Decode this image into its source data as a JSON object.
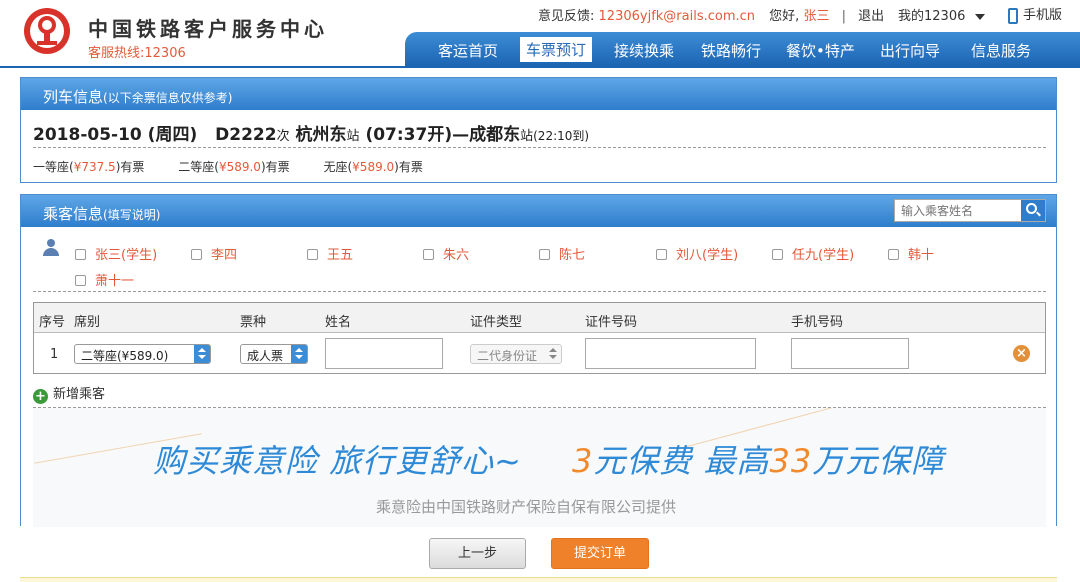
{
  "header": {
    "brand_title": "中国铁路客户服务中心",
    "hotline": "客服热线:12306",
    "feedback_label": "意见反馈:",
    "feedback_email": "12306yjfk@rails.com.cn",
    "greeting": "您好,",
    "user_name": "张三",
    "logout": "退出",
    "my12306": "我的12306",
    "mobile": "手机版"
  },
  "nav": {
    "items": [
      "客运首页",
      "车票预订",
      "接续换乘",
      "铁路畅行",
      "餐饮•特产",
      "出行向导",
      "信息服务"
    ],
    "active": "车票预订"
  },
  "train_panel": {
    "title": "列车信息",
    "subtitle": "(以下余票信息仅供参考)",
    "date": "2018-05-10",
    "weekday": "(周四)",
    "train_no": "D2222",
    "train_suffix": "次",
    "from_station": "杭州东",
    "station_suffix": "站",
    "depart": "(07:37开)",
    "dash": "—",
    "to_station": "成都东",
    "arrive": "(22:10到)",
    "seats": [
      {
        "name": "一等座",
        "price": "¥737.5",
        "status": "有票"
      },
      {
        "name": "二等座",
        "price": "¥589.0",
        "status": "有票"
      },
      {
        "name": "无座",
        "price": "¥589.0",
        "status": "有票"
      }
    ]
  },
  "passenger_panel": {
    "title": "乘客信息",
    "subtitle": "(填写说明)",
    "search_placeholder": "输入乘客姓名",
    "passengers": [
      "张三(学生)",
      "李四",
      "王五",
      "朱六",
      "陈七",
      "刘八(学生)",
      "任九(学生)",
      "韩十",
      "萧十一"
    ],
    "table_headers": [
      "序号",
      "席别",
      "票种",
      "姓名",
      "证件类型",
      "证件号码",
      "手机号码"
    ],
    "rows": [
      {
        "index": "1",
        "seat": "二等座(¥589.0)",
        "ticket_type": "成人票",
        "name": "",
        "id_type": "二代身份证",
        "id_no": "",
        "phone": ""
      }
    ],
    "add_passenger": "新增乘客"
  },
  "banner": {
    "part1": "购买乘意险  旅行更舒心~",
    "num1": "3",
    "part2": "元保费  最高",
    "num2": "33",
    "part3": "万元保障",
    "sub": "乘意险由中国铁路财产保险自保有限公司提供"
  },
  "buttons": {
    "prev": "上一步",
    "submit": "提交订单"
  },
  "colors": {
    "accent_blue": "#1c65b3",
    "accent_orange": "#f0812b",
    "price_red": "#e4593a"
  }
}
